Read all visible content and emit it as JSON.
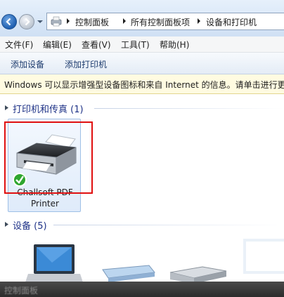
{
  "address_bar": {
    "breadcrumbs": [
      "控制面板",
      "所有控制面板项",
      "设备和打印机"
    ]
  },
  "menu": {
    "items": [
      "文件(F)",
      "编辑(E)",
      "查看(V)",
      "工具(T)",
      "帮助(H)"
    ]
  },
  "commands": {
    "add_device": "添加设备",
    "add_printer": "添加打印机"
  },
  "info_bar": {
    "text": "Windows 可以显示增强型设备图标和来自 Internet 的信息。请单击进行更"
  },
  "groups": {
    "printers": {
      "title": "打印机和传真 (1)"
    },
    "devices": {
      "title": "设备 (5)"
    }
  },
  "printer": {
    "name_line1": "Challsoft PDF",
    "name_line2": "Printer"
  },
  "taskbar": {
    "label": "控制面板"
  },
  "colors": {
    "highlight": "#e01010",
    "group_title": "#1e3287",
    "default_check": "#2fa62f"
  }
}
